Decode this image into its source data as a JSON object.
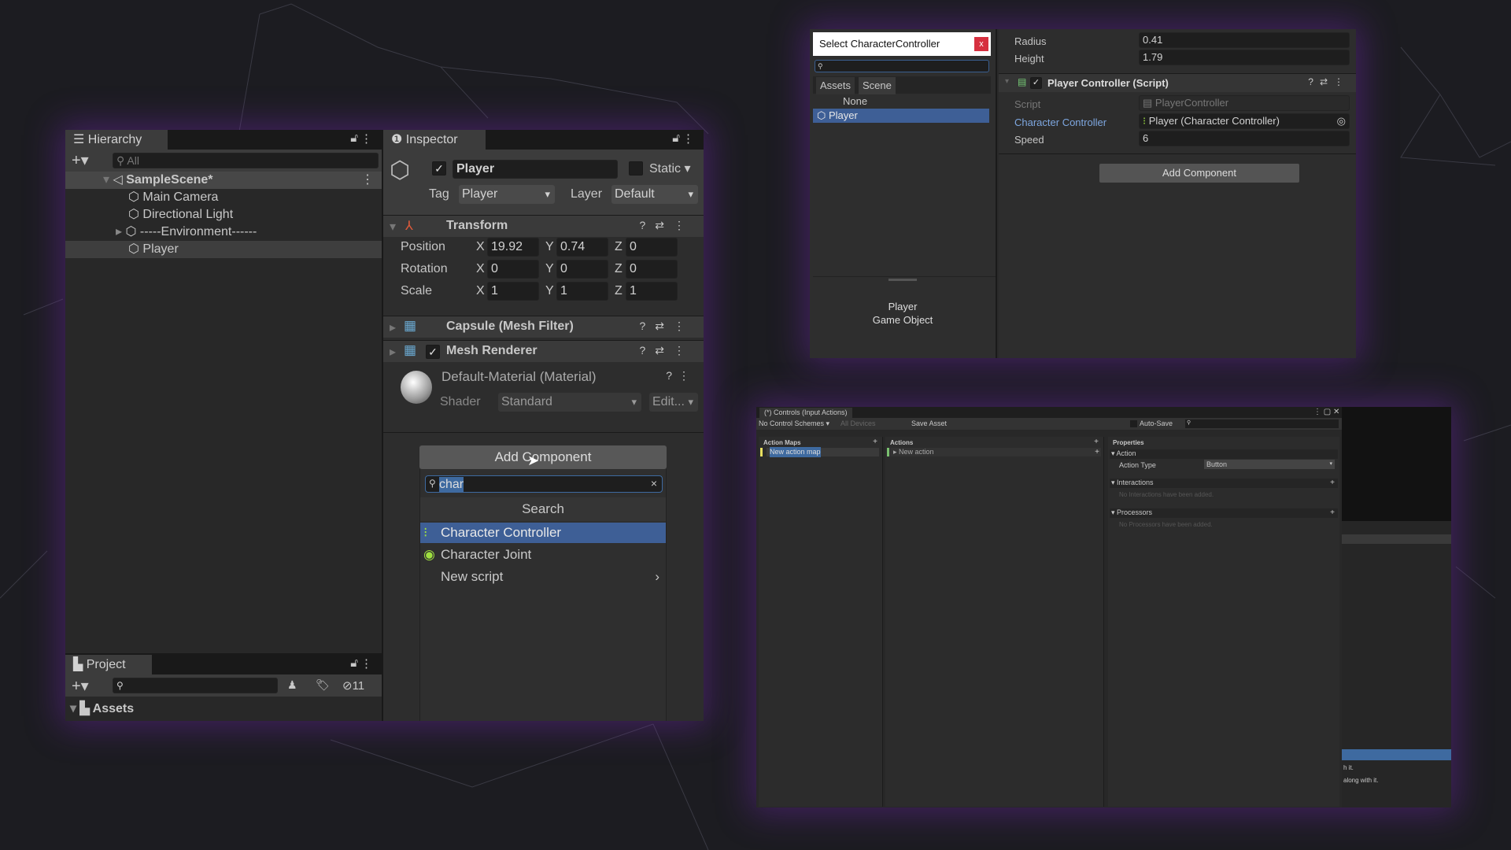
{
  "hierarchy": {
    "tab": "Hierarchy",
    "search_placeholder": "All",
    "scene": "SampleScene*",
    "items": [
      "Main Camera",
      "Directional Light",
      "-----Environment------",
      "Player"
    ]
  },
  "project": {
    "tab": "Project",
    "hidden_count": "11",
    "root": "Assets"
  },
  "inspector": {
    "tab": "Inspector",
    "object_name": "Player",
    "active": true,
    "static_label": "Static",
    "tag_label": "Tag",
    "tag_value": "Player",
    "layer_label": "Layer",
    "layer_value": "Default",
    "transform": {
      "title": "Transform",
      "rows": [
        {
          "label": "Position",
          "x": "19.92",
          "y": "0.74",
          "z": "0"
        },
        {
          "label": "Rotation",
          "x": "0",
          "y": "0",
          "z": "0"
        },
        {
          "label": "Scale",
          "x": "1",
          "y": "1",
          "z": "1"
        }
      ],
      "axes": [
        "X",
        "Y",
        "Z"
      ]
    },
    "mesh_filter": "Capsule (Mesh Filter)",
    "mesh_renderer": "Mesh Renderer",
    "material": "Default-Material (Material)",
    "shader_label": "Shader",
    "shader_value": "Standard",
    "edit_label": "Edit...",
    "add_component": "Add Component"
  },
  "add_component_popup": {
    "search_value": "char",
    "section": "Search",
    "items": [
      "Character Controller",
      "Character Joint",
      "New script"
    ],
    "selected": "Character Controller"
  },
  "select_window": {
    "title": "Select CharacterController",
    "close": "x",
    "tabs": [
      "Assets",
      "Scene"
    ],
    "items": [
      "None",
      "Player"
    ],
    "selected": "Player",
    "preview_name": "Player",
    "preview_type": "Game Object"
  },
  "inspector2": {
    "radius_label": "Radius",
    "radius": "0.41",
    "height_label": "Height",
    "height": "1.79",
    "component": "Player Controller (Script)",
    "script_label": "Script",
    "script_value": "PlayerController",
    "cc_label": "Character Controller",
    "cc_value": "Player (Character Controller)",
    "speed_label": "Speed",
    "speed": "6",
    "add_component": "Add Component"
  },
  "input_actions": {
    "title": "(*) Controls (Input Actions)",
    "schemes": "No Control Schemes ▾",
    "devices": "All Devices",
    "save": "Save Asset",
    "autosave": "Auto-Save",
    "maps_header": "Action Maps",
    "map": "New action map",
    "actions_header": "Actions",
    "action": "New action",
    "props_header": "Properties",
    "action_section": "Action",
    "action_type_label": "Action Type",
    "action_type": "Button",
    "interactions": "Interactions",
    "no_interactions": "No Interactions have been added.",
    "processors": "Processors",
    "no_processors": "No Processors have been added.",
    "side_text1": "h it.",
    "side_text2": "along with it."
  },
  "colors": {
    "selection": "#2c5d87",
    "list_select": "#3e5f96",
    "accent_link": "#7ea7e0",
    "close_red": "#e04050",
    "glow": "#6e28aa"
  }
}
